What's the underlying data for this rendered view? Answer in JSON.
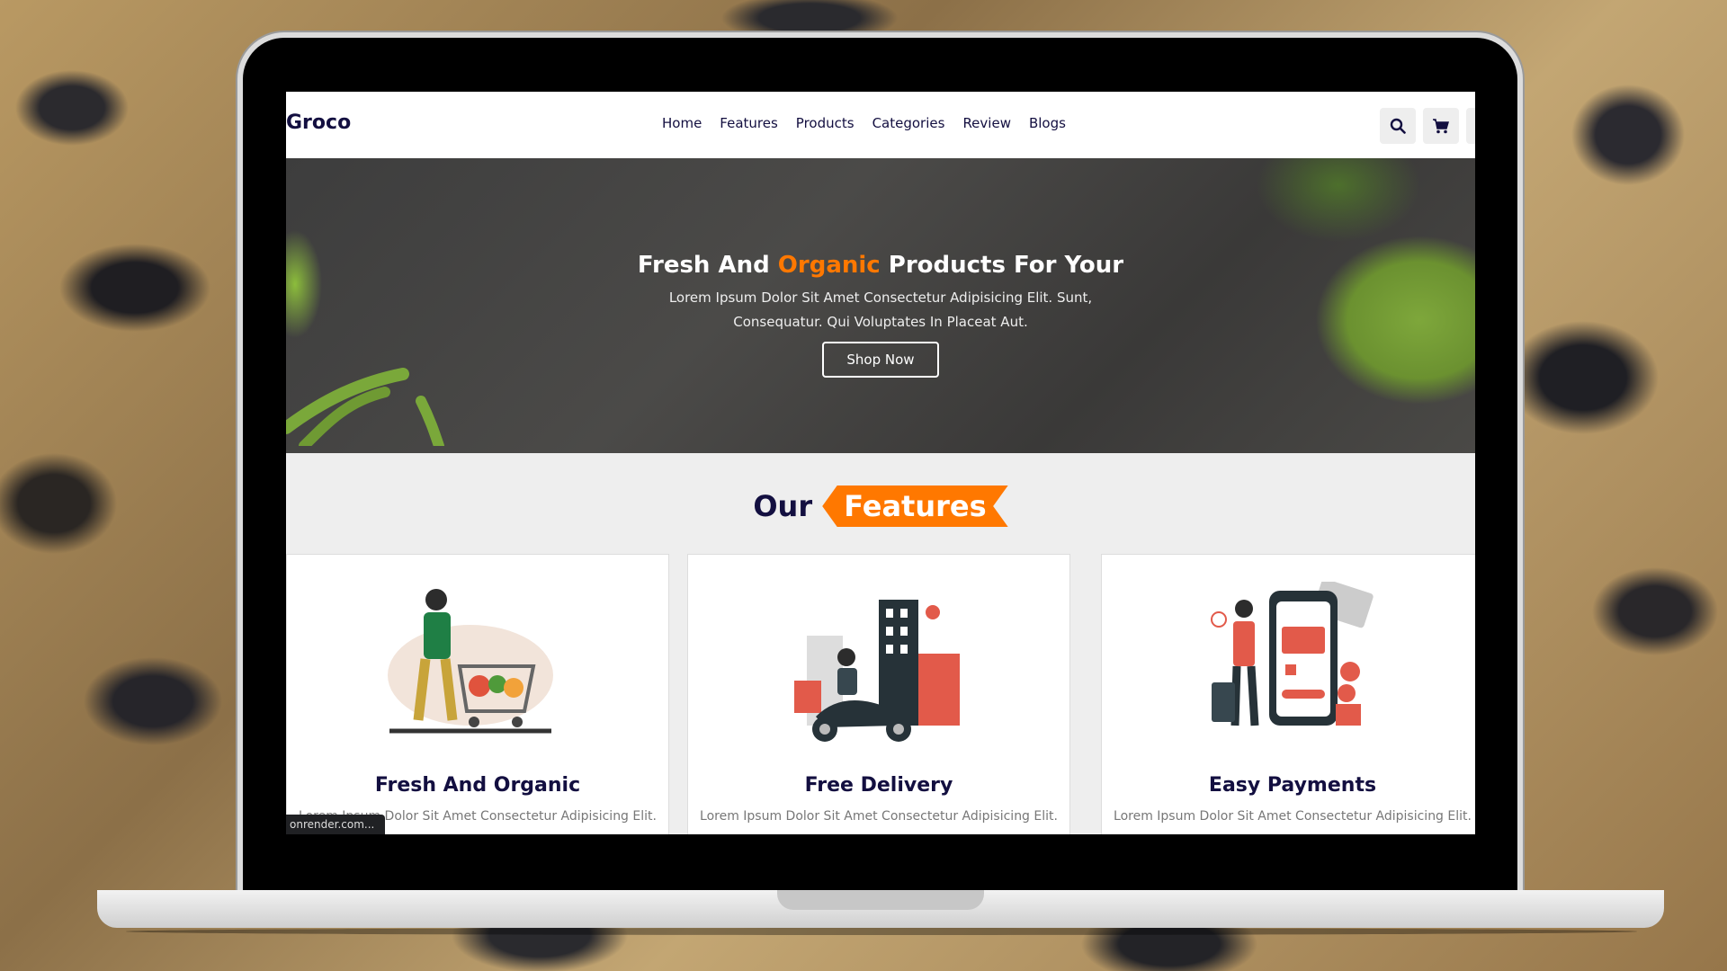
{
  "brand": "Groco",
  "nav": {
    "links": [
      "Home",
      "Features",
      "Products",
      "Categories",
      "Review",
      "Blogs"
    ]
  },
  "icons": [
    "search-icon",
    "cart-icon",
    "user-icon"
  ],
  "hero": {
    "title_before": "Fresh And ",
    "title_accent": "Organic",
    "title_after": " Products For Your",
    "text": "Lorem Ipsum Dolor Sit Amet Consectetur Adipisicing Elit. Sunt, Consequatur. Qui Voluptates In Placeat Aut.",
    "button": "Shop Now"
  },
  "features": {
    "heading_plain": "Our",
    "heading_accent": "Features",
    "cards": [
      {
        "title": "Fresh And Organic",
        "text": "Lorem Ipsum Dolor Sit Amet Consectetur Adipisicing Elit."
      },
      {
        "title": "Free Delivery",
        "text": "Lorem Ipsum Dolor Sit Amet Consectetur Adipisicing Elit."
      },
      {
        "title": "Easy Payments",
        "text": "Lorem Ipsum Dolor Sit Amet Consectetur Adipisicing Elit."
      }
    ]
  },
  "status_tooltip": "onrender.com...",
  "colors": {
    "accent": "#ff7800",
    "dark": "#130f40"
  }
}
